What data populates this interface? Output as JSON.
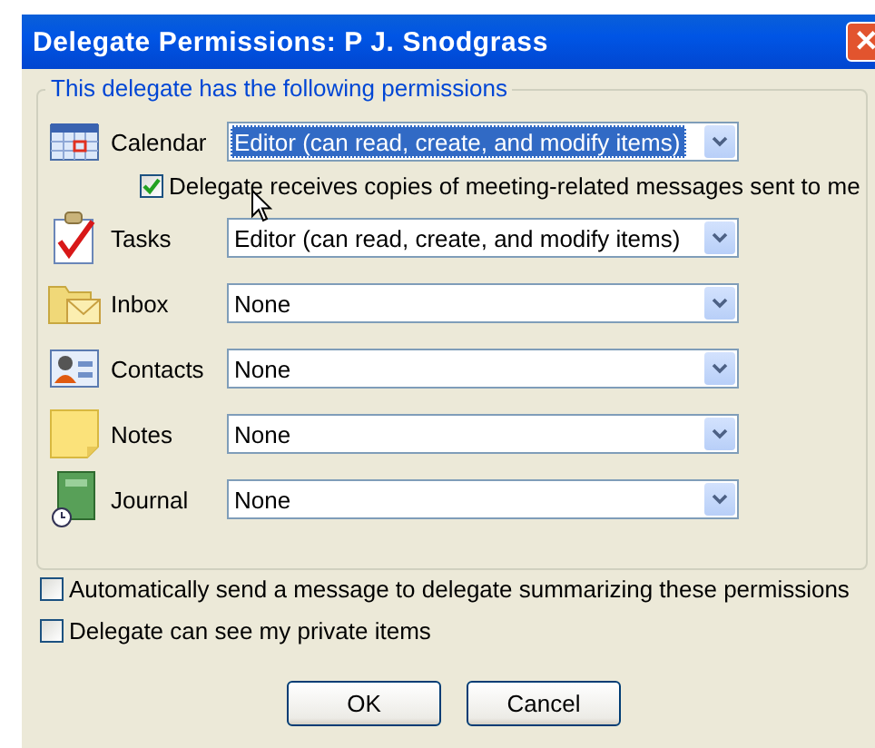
{
  "window": {
    "title": "Delegate Permissions: P J. Snodgrass",
    "close_label": "✕"
  },
  "permissions_group": {
    "title": "This delegate has the following permissions",
    "rows": [
      {
        "label": "Calendar",
        "value": "Editor (can read, create, and modify items)",
        "focused": true,
        "option": {
          "label": "Delegate receives copies of meeting-related messages sent to me",
          "checked": true
        }
      },
      {
        "label": "Tasks",
        "value": "Editor (can read, create, and modify items)",
        "focused": false
      },
      {
        "label": "Inbox",
        "value": "None",
        "focused": false
      },
      {
        "label": "Contacts",
        "value": "None",
        "focused": false
      },
      {
        "label": "Notes",
        "value": "None",
        "focused": false
      },
      {
        "label": "Journal",
        "value": "None",
        "focused": false
      }
    ]
  },
  "options": [
    {
      "label": "Automatically send a message to delegate summarizing these permissions",
      "checked": false
    },
    {
      "label": "Delegate can see my private items",
      "checked": false
    }
  ],
  "buttons": [
    "OK",
    "Cancel"
  ]
}
